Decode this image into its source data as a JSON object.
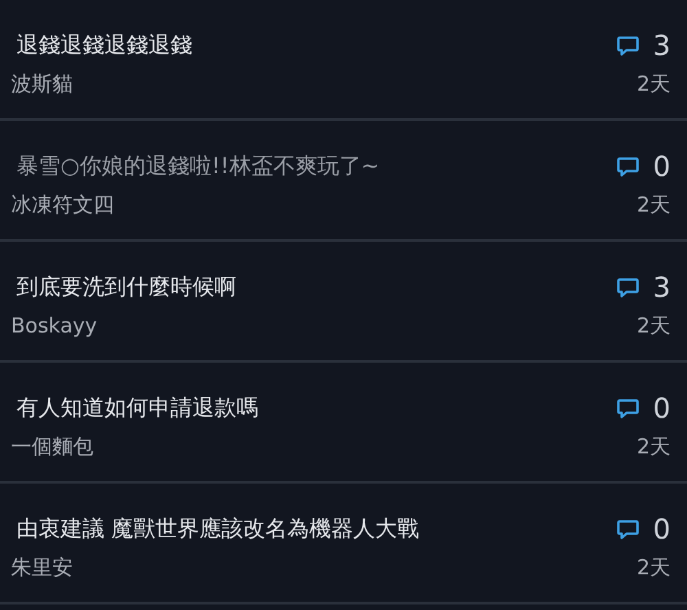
{
  "threads": [
    {
      "title": "退錢退錢退錢退錢",
      "author": "波斯貓",
      "comments": "3",
      "age": "2天",
      "read": false
    },
    {
      "title": "暴雪○你娘的退錢啦!!林盃不爽玩了~",
      "author": "冰凍符文四",
      "comments": "0",
      "age": "2天",
      "read": true
    },
    {
      "title": "到底要洗到什麼時候啊",
      "author": "Boskayy",
      "comments": "3",
      "age": "2天",
      "read": false
    },
    {
      "title": "有人知道如何申請退款嗎",
      "author": "一個麵包",
      "comments": "0",
      "age": "2天",
      "read": false
    },
    {
      "title": "由衷建議 魔獸世界應該改名為機器人大戰",
      "author": "朱里安",
      "comments": "0",
      "age": "2天",
      "read": false
    }
  ]
}
